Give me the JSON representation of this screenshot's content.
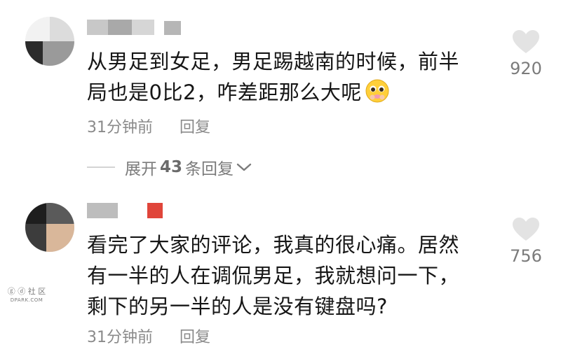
{
  "comments": [
    {
      "text": "从男足到女足，男足踢越南的时候，前半\n局也是0比2，咋差距那么大呢",
      "emoji": "pleading-face",
      "time": "31分钟前",
      "reply_label": "回复",
      "likes": "920",
      "expand": {
        "prefix": "展开",
        "count": "43",
        "suffix": "条回复"
      }
    },
    {
      "text": "看完了大家的评论，我真的很心痛。居然\n有一半的人在调侃男足，我就想问一下，\n剩下的另一半的人是没有键盘吗?",
      "time": "31分钟前",
      "reply_label": "回复",
      "likes": "756"
    }
  ],
  "colors": {
    "text": "#161616",
    "meta": "#8a8a8a",
    "heart": "#e3e3e3",
    "username_red": "#e0453a"
  },
  "icons": [
    "heart-icon",
    "chevron-down-icon",
    "pleading-face-emoji"
  ],
  "watermark": {
    "line1": "ⓖ ⓓ 社 区",
    "line2": "DPARK.COM"
  }
}
